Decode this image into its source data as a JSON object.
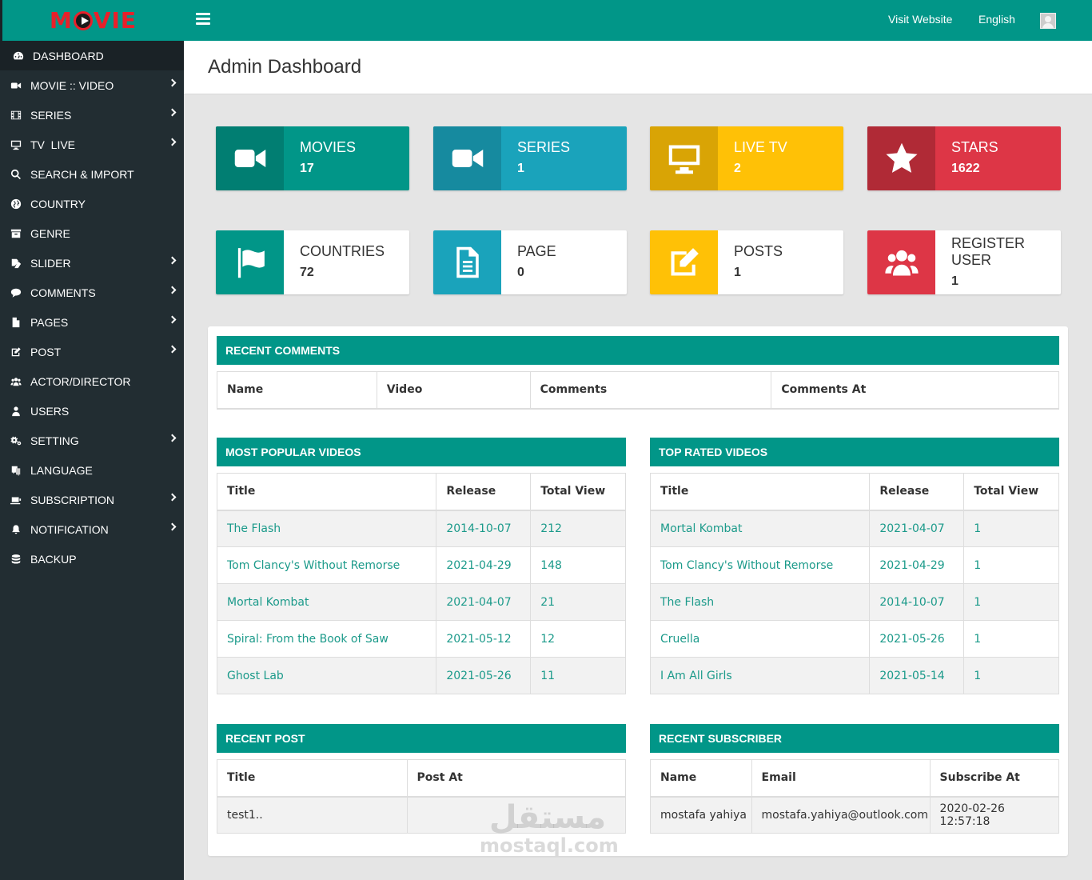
{
  "app": {
    "logo": "MOVIE",
    "logo_prefix": "M",
    "logo_suffix": "VIE"
  },
  "header": {
    "visit_website": "Visit Website",
    "language": "English"
  },
  "sidebar": {
    "items": [
      {
        "label": "DASHBOARD",
        "icon": "dashboard-icon",
        "has_submenu": false,
        "active": true
      },
      {
        "label": "MOVIE :: VIDEO",
        "icon": "video-camera-icon",
        "has_submenu": true
      },
      {
        "label": "SERIES",
        "icon": "film-icon",
        "has_submenu": true
      },
      {
        "label": "TV  LIVE",
        "icon": "monitor-icon",
        "has_submenu": true
      },
      {
        "label": "SEARCH & IMPORT",
        "icon": "search-icon",
        "has_submenu": false
      },
      {
        "label": "COUNTRY",
        "icon": "globe-icon",
        "has_submenu": false
      },
      {
        "label": "GENRE",
        "icon": "archive-icon",
        "has_submenu": false
      },
      {
        "label": "SLIDER",
        "icon": "sliders-icon",
        "has_submenu": true
      },
      {
        "label": "COMMENTS",
        "icon": "comment-icon",
        "has_submenu": true
      },
      {
        "label": "PAGES",
        "icon": "file-icon",
        "has_submenu": true
      },
      {
        "label": "POST",
        "icon": "edit-icon",
        "has_submenu": true
      },
      {
        "label": "ACTOR/DIRECTOR",
        "icon": "users-icon",
        "has_submenu": false
      },
      {
        "label": "USERS",
        "icon": "user-icon",
        "has_submenu": false
      },
      {
        "label": "SETTING",
        "icon": "cogs-icon",
        "has_submenu": true
      },
      {
        "label": "LANGUAGE",
        "icon": "language-icon",
        "has_submenu": false
      },
      {
        "label": "SUBSCRIPTION",
        "icon": "subscription-icon",
        "has_submenu": true
      },
      {
        "label": "NOTIFICATION",
        "icon": "bell-icon",
        "has_submenu": true
      },
      {
        "label": "BACKUP",
        "icon": "database-icon",
        "has_submenu": false
      }
    ]
  },
  "page": {
    "title": "Admin Dashboard"
  },
  "stats": [
    {
      "label": "MOVIES",
      "value": "17",
      "icon": "video-camera-icon",
      "color": "#019688",
      "icon_bg": "#017e72",
      "style": "solid"
    },
    {
      "label": "SERIES",
      "value": "1",
      "icon": "video-camera-icon",
      "color": "#1aa3bb",
      "icon_bg": "#168a9f",
      "style": "solid"
    },
    {
      "label": "LIVE TV",
      "value": "2",
      "icon": "monitor-icon",
      "color": "#ffc106",
      "icon_bg": "#d9a405",
      "style": "solid"
    },
    {
      "label": "STARS",
      "value": "1622",
      "icon": "star-icon",
      "color": "#dd3646",
      "icon_bg": "#b02a36",
      "style": "solid"
    },
    {
      "label": "COUNTRIES",
      "value": "72",
      "icon": "flag-icon",
      "color": "#ffffff",
      "icon_bg": "#019688",
      "style": "light"
    },
    {
      "label": "PAGE",
      "value": "0",
      "icon": "document-icon",
      "color": "#ffffff",
      "icon_bg": "#1aa3bb",
      "style": "light"
    },
    {
      "label": "POSTS",
      "value": "1",
      "icon": "edit-icon",
      "color": "#ffffff",
      "icon_bg": "#ffc106",
      "style": "light"
    },
    {
      "label": "REGISTER USER",
      "value": "1",
      "icon": "users-icon",
      "color": "#ffffff",
      "icon_bg": "#dd3646",
      "style": "light"
    }
  ],
  "recent_comments": {
    "title": "RECENT COMMENTS",
    "columns": [
      "Name",
      "Video",
      "Comments",
      "Comments At"
    ],
    "rows": []
  },
  "popular_videos": {
    "title": "MOST POPULAR VIDEOS",
    "columns": [
      "Title",
      "Release",
      "Total View"
    ],
    "rows": [
      [
        "The Flash",
        "2014-10-07",
        "212"
      ],
      [
        "Tom Clancy's Without Remorse",
        "2021-04-29",
        "148"
      ],
      [
        "Mortal Kombat",
        "2021-04-07",
        "21"
      ],
      [
        "Spiral: From the Book of Saw",
        "2021-05-12",
        "12"
      ],
      [
        "Ghost Lab",
        "2021-05-26",
        "11"
      ]
    ]
  },
  "top_rated_videos": {
    "title": "TOP RATED VIDEOS",
    "columns": [
      "Title",
      "Release",
      "Total View"
    ],
    "rows": [
      [
        "Mortal Kombat",
        "2021-04-07",
        "1"
      ],
      [
        "Tom Clancy's Without Remorse",
        "2021-04-29",
        "1"
      ],
      [
        "The Flash",
        "2014-10-07",
        "1"
      ],
      [
        "Cruella",
        "2021-05-26",
        "1"
      ],
      [
        "I Am All Girls",
        "2021-05-14",
        "1"
      ]
    ]
  },
  "recent_post": {
    "title": "RECENT POST",
    "columns": [
      "Title",
      "Post At"
    ],
    "rows": [
      [
        "test1..",
        ""
      ]
    ]
  },
  "recent_subscriber": {
    "title": "RECENT SUBSCRIBER",
    "columns": [
      "Name",
      "Email",
      "Subscribe At"
    ],
    "rows": [
      [
        "mostafa yahiya",
        "mostafa.yahiya@outlook.com",
        "2020-02-26 12:57:18"
      ]
    ]
  },
  "watermark": {
    "arabic": "مستقل",
    "latin": "mostaql.com"
  }
}
